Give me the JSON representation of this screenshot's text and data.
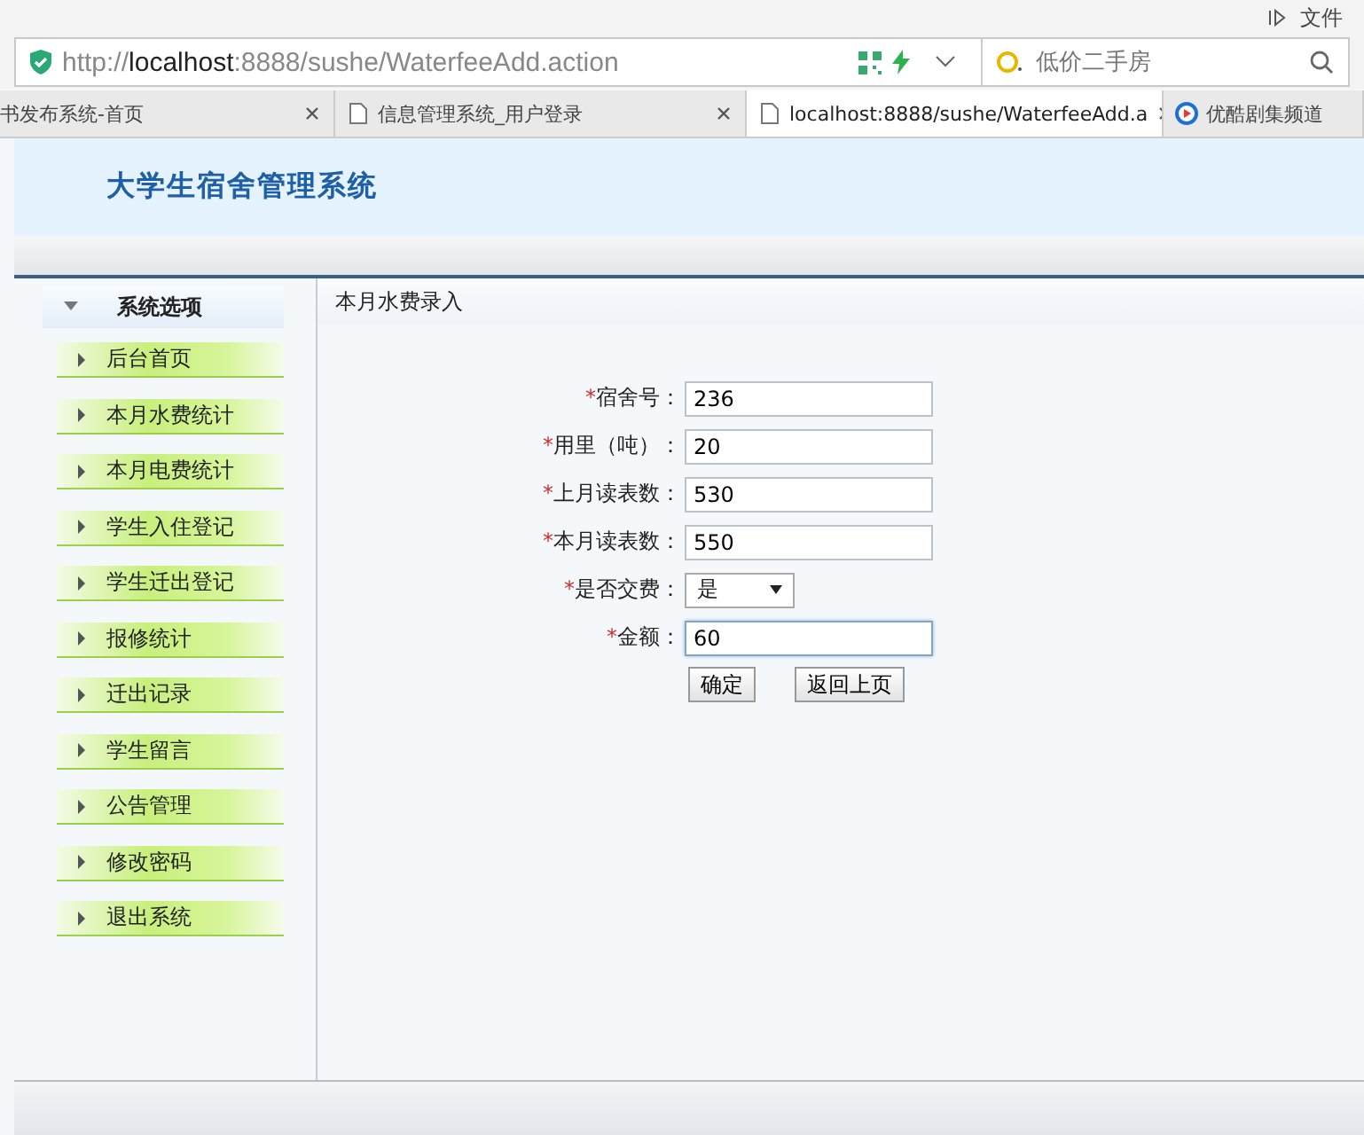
{
  "browser": {
    "menu": "文件",
    "url_prefix": "http://",
    "url_host": "localhost",
    "url_rest": ":8888/sushe/WaterfeeAdd.action",
    "search": {
      "placeholder": "低价二手房"
    },
    "tabs": [
      {
        "label": "书发布系统-首页",
        "selected": false,
        "kind": "plain"
      },
      {
        "label": "信息管理系统_用户登录",
        "selected": false,
        "kind": "page"
      },
      {
        "label": "localhost:8888/sushe/WaterfeeAdd.a",
        "selected": true,
        "kind": "page"
      },
      {
        "label": "优酷剧集频道",
        "selected": false,
        "kind": "video"
      }
    ]
  },
  "app": {
    "title": "大学生宿舍管理系统"
  },
  "sidebar": {
    "header": "系统选项",
    "expanded": true,
    "items": [
      "后台首页",
      "本月水费统计",
      "本月电费统计",
      "学生入住登记",
      "学生迁出登记",
      "报修统计",
      "迁出记录",
      "学生留言",
      "公告管理",
      "修改密码",
      "退出系统"
    ]
  },
  "main": {
    "title": "本月水费录入",
    "form": [
      {
        "mark": "*",
        "label": "宿舍号：",
        "kind": "text",
        "value": "236",
        "focused": false
      },
      {
        "mark": "*",
        "label": "用里（吨）：",
        "kind": "text",
        "value": "20",
        "focused": false
      },
      {
        "mark": "*",
        "label": "上月读表数：",
        "kind": "text",
        "value": "530",
        "focused": false
      },
      {
        "mark": "*",
        "label": "本月读表数：",
        "kind": "text",
        "value": "550",
        "focused": false
      },
      {
        "mark": "*",
        "label": "是否交费：",
        "kind": "select",
        "value": "是",
        "focused": false
      },
      {
        "mark": "*",
        "label": "金额：",
        "kind": "text",
        "value": "60",
        "focused": true
      }
    ],
    "buttons": [
      "确定",
      "返回上页"
    ]
  }
}
